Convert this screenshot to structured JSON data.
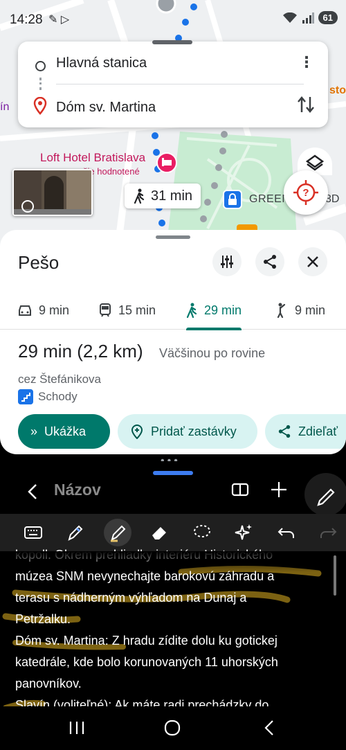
{
  "status_bar": {
    "time": "14:28",
    "battery": "61"
  },
  "route": {
    "origin": "Hlavná stanica",
    "destination": "Dóm sv. Martina"
  },
  "map": {
    "hotel_name": "Loft Hotel Bratislava",
    "hotel_sub": "šie hodnotené",
    "green_label": "GREEN",
    "green_tail": "3D",
    "orange_label": "sto",
    "purple_label": "ín",
    "walk_time": "31 min"
  },
  "sheet": {
    "title": "Pešo",
    "modes": [
      {
        "name": "car",
        "label": "9 min"
      },
      {
        "name": "transit",
        "label": "15 min"
      },
      {
        "name": "walk",
        "label": "29 min",
        "active": true
      },
      {
        "name": "rideshare",
        "label": "9 min"
      }
    ],
    "summary": "29 min (2,2 km)",
    "summary_sub": "Väčšinou po rovine",
    "via": "cez Štefánikova",
    "stairs": "Schody",
    "actions": {
      "preview": "Ukážka",
      "add_stops": "Pridať zastávky",
      "share": "Zdieľať"
    }
  },
  "notes": {
    "title": "Názov",
    "text_line_0": "kopoll. Okrem prehliadky interiéru Historického",
    "text_line_1": "múzea SNM nevynechajte barokovú záhradu a",
    "text_line_2": "terasu s nádherným výhľadom na Dunaj a",
    "text_line_3": "Petržalku.",
    "text_line_4": "Dóm sv. Martina: Z hradu zídite dolu ku gotickej",
    "text_line_5": "katedrále, kde bolo korunovaných 11 uhorských",
    "text_line_6": "panovníkov.",
    "text_line_7": "Slavín (voliteľné): Ak máte radi prechádzky do"
  },
  "colors": {
    "accent": "#00796b",
    "chip_bg": "#d8f3f2",
    "route_blue": "#1a73e8",
    "highlighter": "#8a6d14"
  }
}
